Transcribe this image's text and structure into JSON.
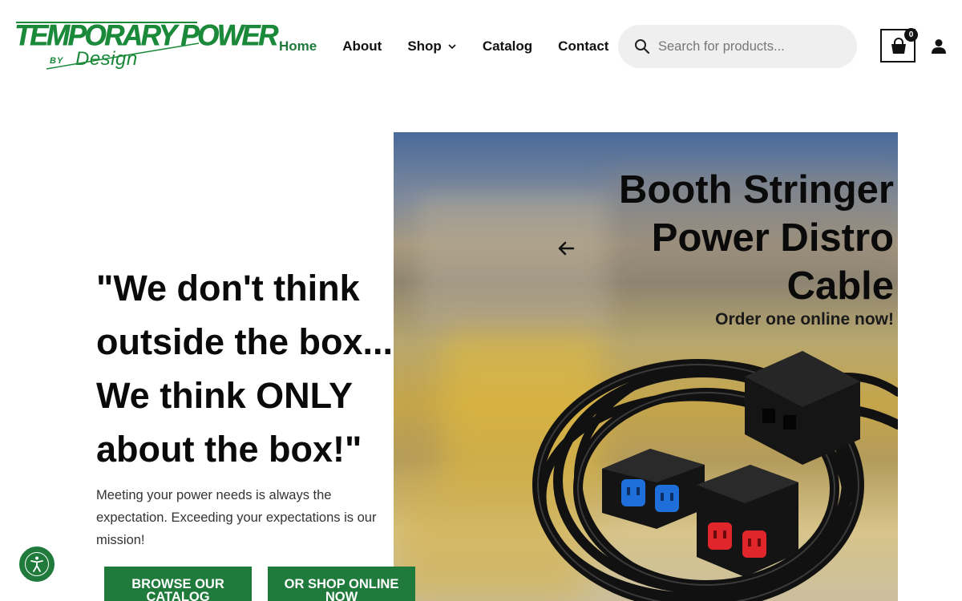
{
  "brand": {
    "logo_top": "TEMPORARY POWER",
    "logo_by": "BY",
    "logo_design": "Design",
    "color": "#1a8a3a"
  },
  "nav": {
    "items": [
      {
        "label": "Home",
        "active": true
      },
      {
        "label": "About",
        "active": false
      },
      {
        "label": "Shop",
        "active": false,
        "dropdown": true
      },
      {
        "label": "Catalog",
        "active": false
      },
      {
        "label": "Contact",
        "active": false
      }
    ],
    "active_color": "#1f7a3c"
  },
  "search": {
    "placeholder": "Search for products...",
    "value": "",
    "icon": "search-icon"
  },
  "cart": {
    "count": "0",
    "icon": "shopping-bag-icon"
  },
  "account": {
    "icon": "user-icon"
  },
  "hero": {
    "quote": "\"We don't think outside the box... We think ONLY about the box!\"",
    "lead": "Meeting your power needs is always the expectation. Exceeding your expectations is our mission!",
    "buttons": [
      {
        "label": "BROWSE OUR CATALOG"
      },
      {
        "label": "OR SHOP ONLINE NOW"
      }
    ],
    "button_color": "#1f7a3c"
  },
  "slide": {
    "title": "Booth Stringer Power Distro Cable",
    "subtitle": "Order one online now!",
    "prev_icon": "arrow-left-icon",
    "outlet_colors": [
      "#1e6fd9",
      "#e0262b"
    ]
  },
  "accessibility": {
    "icon": "accessibility-icon"
  }
}
